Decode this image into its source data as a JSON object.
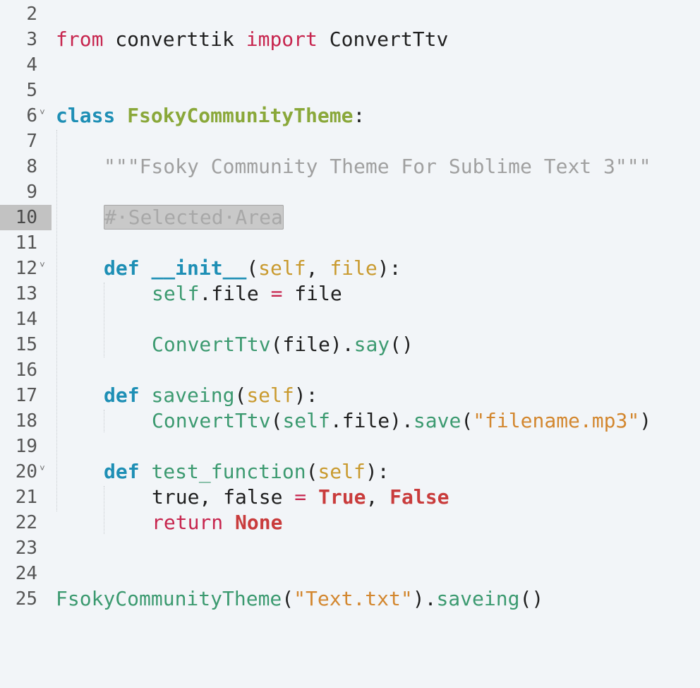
{
  "editor": {
    "current_line": "10",
    "lines": [
      {
        "num": "2"
      },
      {
        "num": "3",
        "t": [
          "from",
          " converttik ",
          "import",
          " ConvertTtv"
        ]
      },
      {
        "num": "4"
      },
      {
        "num": "5"
      },
      {
        "num": "6",
        "fold": "˅",
        "t": [
          "class",
          " ",
          "FsokyCommunityTheme",
          ":"
        ]
      },
      {
        "num": "7"
      },
      {
        "num": "8",
        "t": [
          "\"\"\"Fsoky Community Theme For Sublime Text 3\"\"\""
        ]
      },
      {
        "num": "9"
      },
      {
        "num": "10",
        "t": [
          "#·Selected·Area"
        ]
      },
      {
        "num": "11"
      },
      {
        "num": "12",
        "fold": "˅",
        "t": [
          "def",
          " ",
          "__init__",
          "(",
          "self",
          ", ",
          "file",
          "):"
        ]
      },
      {
        "num": "13",
        "t": [
          "self",
          ".file ",
          "=",
          " file"
        ]
      },
      {
        "num": "14"
      },
      {
        "num": "15",
        "t": [
          "ConvertTtv",
          "(file).",
          "say",
          "()"
        ]
      },
      {
        "num": "16"
      },
      {
        "num": "17",
        "t": [
          "def",
          " ",
          "saveing",
          "(",
          "self",
          "):"
        ]
      },
      {
        "num": "18",
        "t": [
          "ConvertTtv",
          "(",
          "self",
          ".file).",
          "save",
          "(",
          "\"filename.mp3\"",
          ")"
        ]
      },
      {
        "num": "19"
      },
      {
        "num": "20",
        "fold": "˅",
        "t": [
          "def",
          " ",
          "test_function",
          "(",
          "self",
          "):"
        ]
      },
      {
        "num": "21",
        "t": [
          "true, false ",
          "=",
          " ",
          "True",
          ", ",
          "False"
        ]
      },
      {
        "num": "22",
        "t": [
          "return",
          " ",
          "None"
        ]
      },
      {
        "num": "23"
      },
      {
        "num": "24"
      },
      {
        "num": "25",
        "t": [
          "FsokyCommunityTheme",
          "(",
          "\"Text.txt\"",
          ").",
          "saveing",
          "()"
        ]
      }
    ]
  }
}
